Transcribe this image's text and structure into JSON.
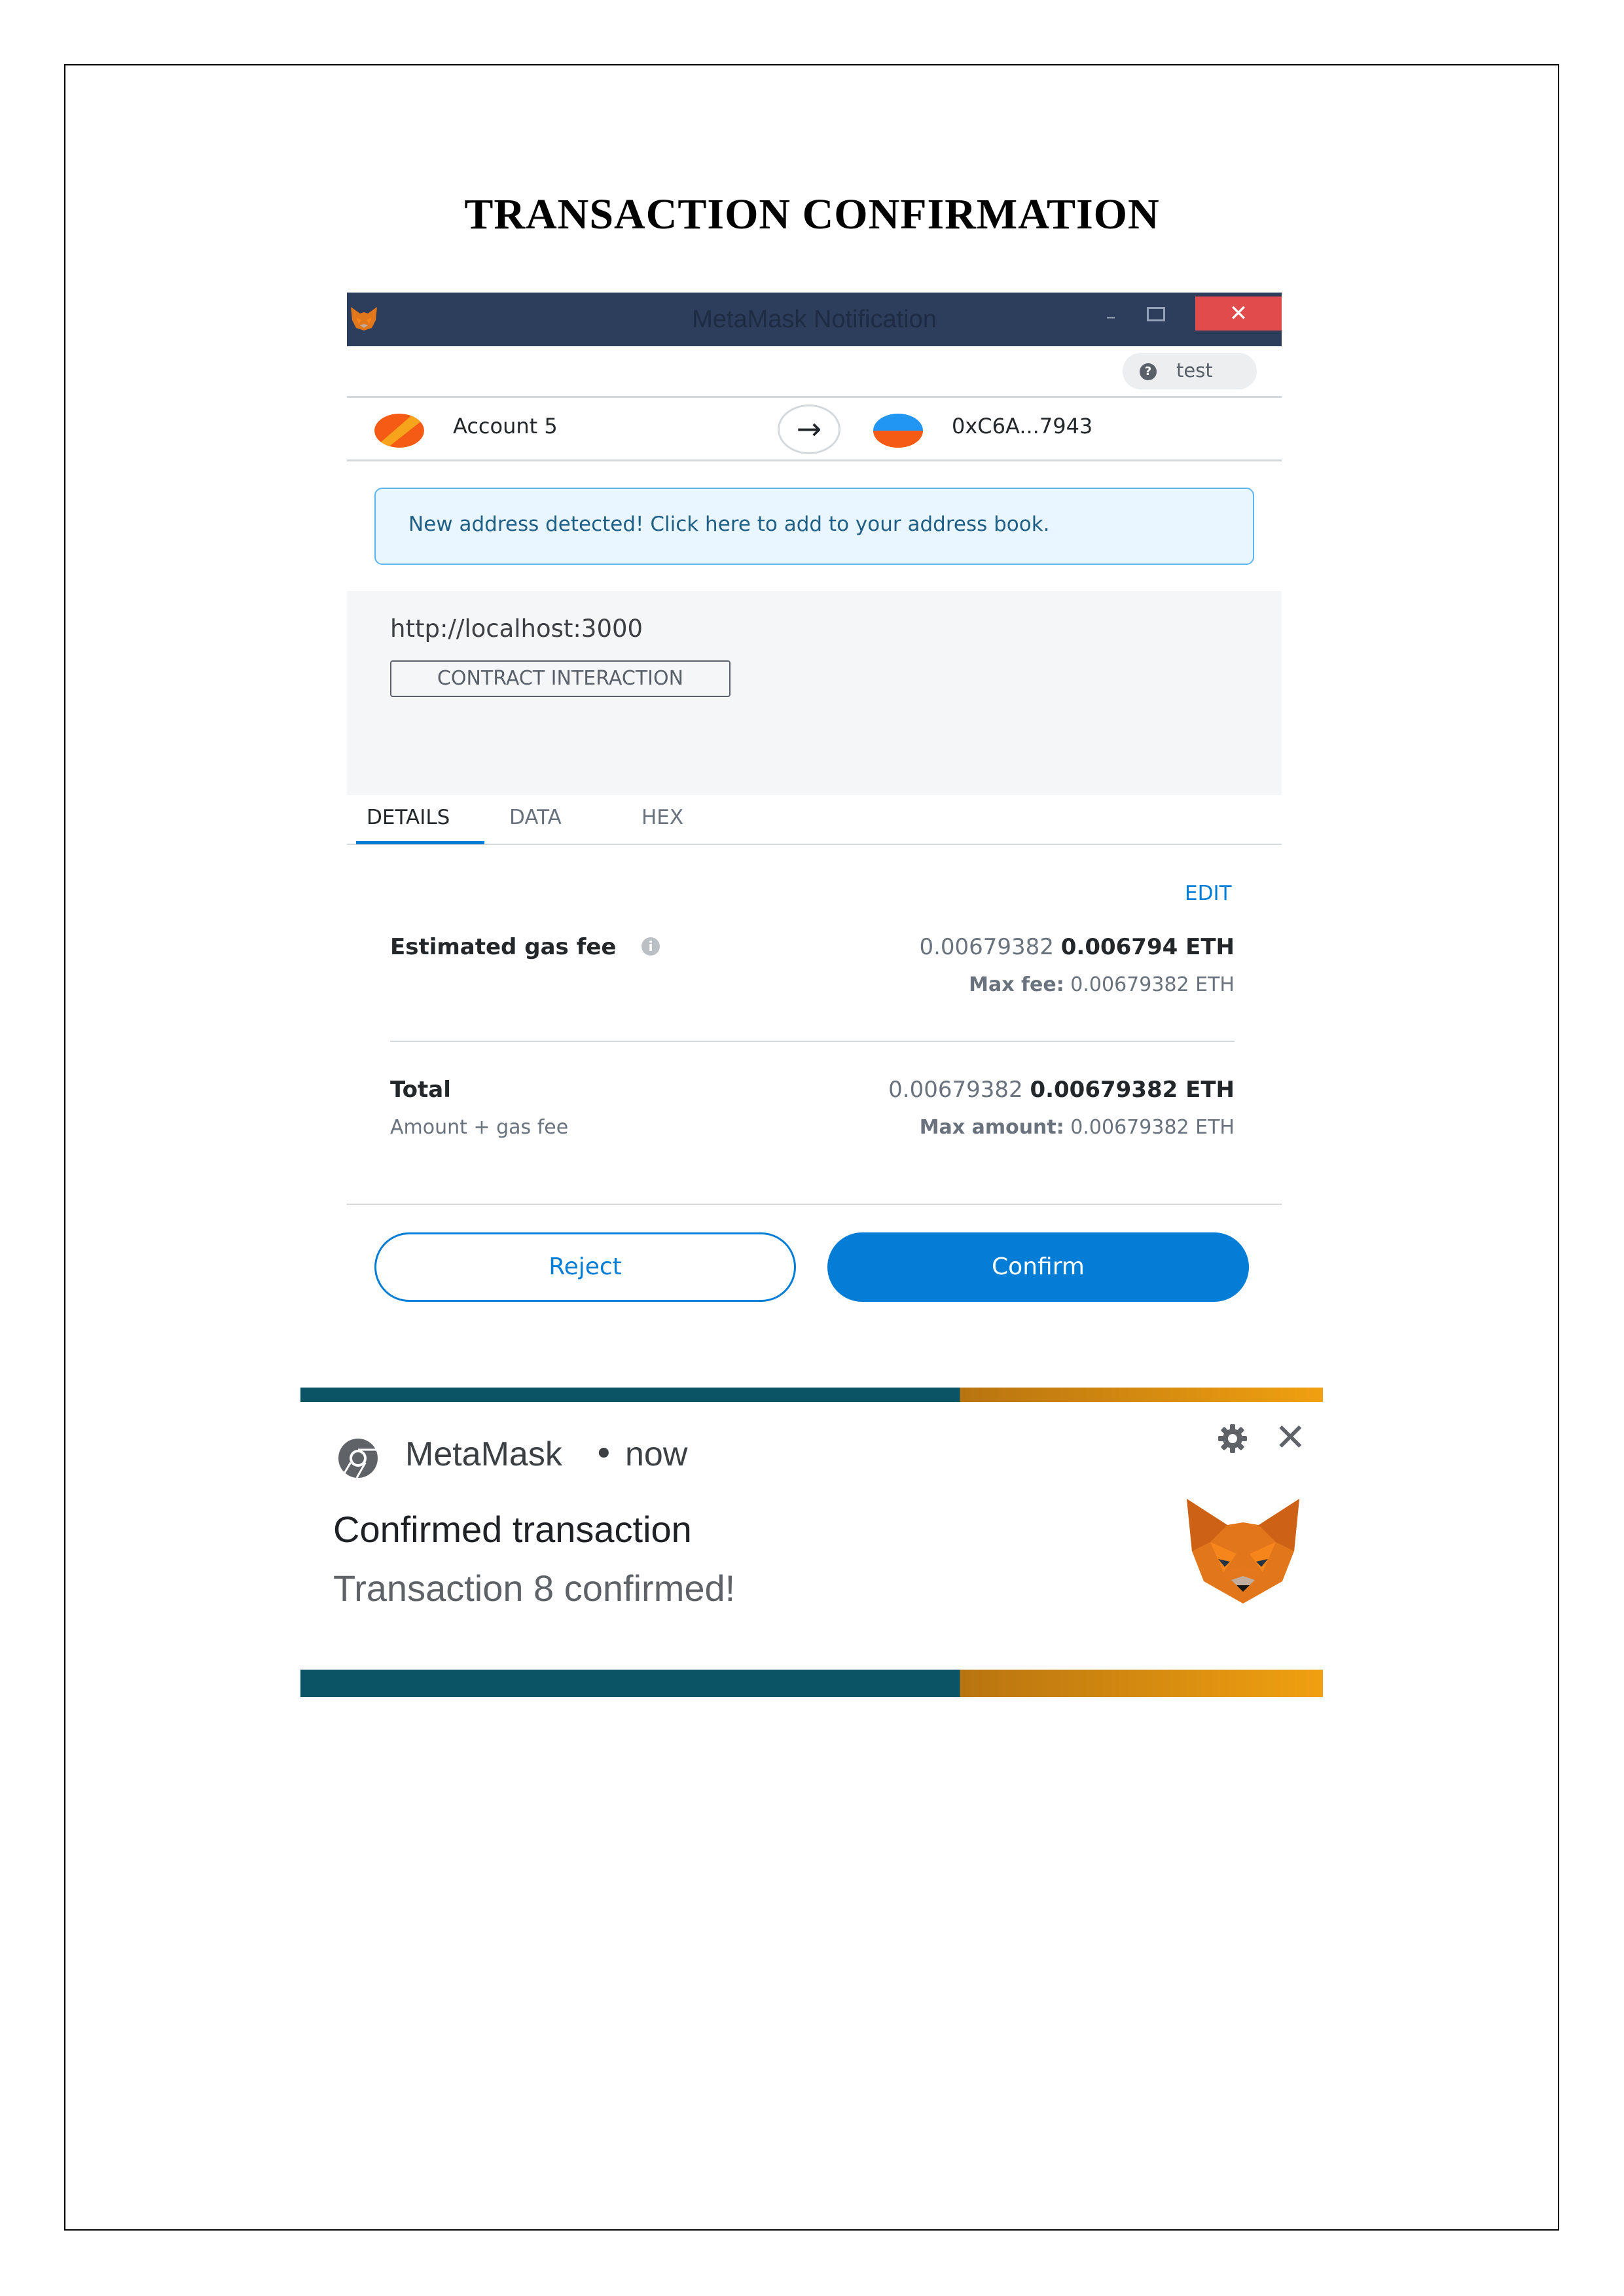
{
  "document": {
    "title": "TRANSACTION CONFIRMATION"
  },
  "window": {
    "title": "MetaMask Notification",
    "minimize_glyph": "–",
    "close_glyph": "✕"
  },
  "network": {
    "label": "test"
  },
  "accounts": {
    "from_name": "Account 5",
    "to_address": "0xC6A...7943"
  },
  "banner": {
    "text": "New address detected! Click here to add to your address book."
  },
  "origin": {
    "url": "http://localhost:3000",
    "method": "CONTRACT INTERACTION"
  },
  "tabs": [
    {
      "label": "DETAILS",
      "active": true
    },
    {
      "label": "DATA",
      "active": false
    },
    {
      "label": "HEX",
      "active": false
    }
  ],
  "details": {
    "edit_label": "EDIT",
    "gas": {
      "label": "Estimated gas fee",
      "value_secondary": "0.00679382",
      "value_primary": "0.006794 ETH",
      "max_fee_label": "Max fee:",
      "max_fee_value": "0.00679382 ETH"
    },
    "total": {
      "label": "Total",
      "sublabel": "Amount + gas fee",
      "value_secondary": "0.00679382",
      "value_primary": "0.00679382 ETH",
      "max_amount_label": "Max amount:",
      "max_amount_value": "0.00679382 ETH"
    }
  },
  "actions": {
    "reject_label": "Reject",
    "confirm_label": "Confirm"
  },
  "toast": {
    "app_name": "MetaMask",
    "separator": "•",
    "time": "now",
    "close_glyph": "✕",
    "title": "Confirmed transaction",
    "message": "Transaction 8 confirmed!"
  },
  "colors": {
    "titlebar": "#2c3e5c",
    "accent_blue": "#037dd6",
    "close_red": "#e24b4b",
    "stripe_teal": "#0a5466",
    "stripe_orange": "#f0a010",
    "fox_orange": "#e2761b"
  },
  "icons": [
    "metamask-fox-icon",
    "question-icon",
    "arrow-right-icon",
    "info-icon",
    "chrome-icon",
    "gear-icon",
    "close-icon"
  ]
}
